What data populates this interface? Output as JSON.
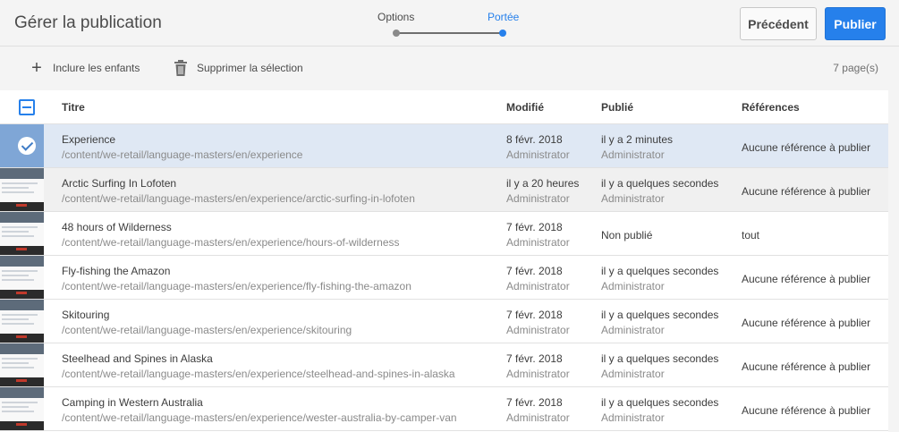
{
  "header": {
    "title": "Gérer la publication",
    "steps": [
      "Options",
      "Portée"
    ],
    "active_step": "Portée",
    "prev_label": "Précédent",
    "publish_label": "Publier",
    "accent_color": "#2680eb"
  },
  "toolbar": {
    "include_children": "Inclure les enfants",
    "include_icon": "plus-icon",
    "delete_selection": "Supprimer la sélection",
    "delete_icon": "trash-icon",
    "page_count": "7 page(s)"
  },
  "table": {
    "columns": {
      "title": "Titre",
      "modified": "Modifié",
      "published": "Publié",
      "references": "Références"
    },
    "rows": [
      {
        "title": "Experience",
        "path": "/content/we-retail/language-masters/en/experience",
        "modified": "8 févr. 2018",
        "modified_by": "Administrator",
        "published": "il y a 2 minutes",
        "published_by": "Administrator",
        "references": "Aucune référence à publier",
        "selected": true
      },
      {
        "title": "Arctic Surfing In Lofoten",
        "path": "/content/we-retail/language-masters/en/experience/arctic-surfing-in-lofoten",
        "modified": "il y a 20 heures",
        "modified_by": "Administrator",
        "published": "il y a quelques secondes",
        "published_by": "Administrator",
        "references": "Aucune référence à publier",
        "selected": false
      },
      {
        "title": "48 hours of Wilderness",
        "path": "/content/we-retail/language-masters/en/experience/hours-of-wilderness",
        "modified": "7 févr. 2018",
        "modified_by": "Administrator",
        "published": "Non publié",
        "published_by": "",
        "references": "tout",
        "selected": false
      },
      {
        "title": "Fly-fishing the Amazon",
        "path": "/content/we-retail/language-masters/en/experience/fly-fishing-the-amazon",
        "modified": "7 févr. 2018",
        "modified_by": "Administrator",
        "published": "il y a quelques secondes",
        "published_by": "Administrator",
        "references": "Aucune référence à publier",
        "selected": false
      },
      {
        "title": "Skitouring",
        "path": "/content/we-retail/language-masters/en/experience/skitouring",
        "modified": "7 févr. 2018",
        "modified_by": "Administrator",
        "published": "il y a quelques secondes",
        "published_by": "Administrator",
        "references": "Aucune référence à publier",
        "selected": false
      },
      {
        "title": "Steelhead and Spines in Alaska",
        "path": "/content/we-retail/language-masters/en/experience/steelhead-and-spines-in-alaska",
        "modified": "7 févr. 2018",
        "modified_by": "Administrator",
        "published": "il y a quelques secondes",
        "published_by": "Administrator",
        "references": "Aucune référence à publier",
        "selected": false
      },
      {
        "title": "Camping in Western Australia",
        "path": "/content/we-retail/language-masters/en/experience/wester-australia-by-camper-van",
        "modified": "7 févr. 2018",
        "modified_by": "Administrator",
        "published": "il y a quelques secondes",
        "published_by": "Administrator",
        "references": "Aucune référence à publier",
        "selected": false
      }
    ]
  }
}
